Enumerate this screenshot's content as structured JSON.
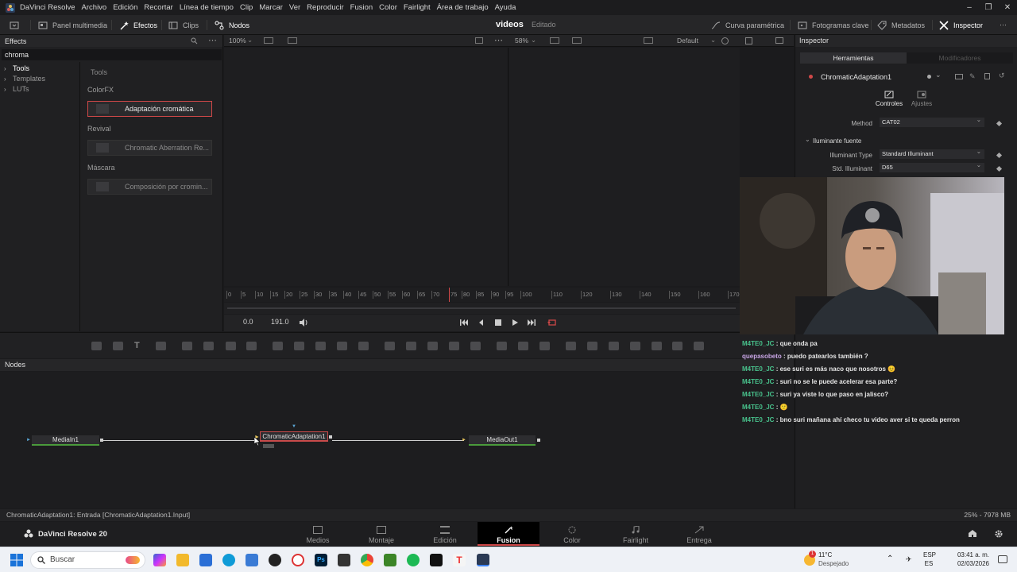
{
  "menubar": {
    "app_name": "DaVinci Resolve",
    "items": [
      "Archivo",
      "Edición",
      "Recortar",
      "Línea de tiempo",
      "Clip",
      "Marcar",
      "Ver",
      "Reproducir",
      "Fusion",
      "Color",
      "Fairlight",
      "Área de trabajo",
      "Ayuda"
    ]
  },
  "toolbar": {
    "media_pool": "Panel multimedia",
    "effects": "Efectos",
    "clips": "Clips",
    "nodes": "Nodos",
    "project_title": "videos",
    "project_state": "Editado",
    "spline": "Curva paramétrica",
    "keyframes": "Fotogramas clave",
    "metadata": "Metadatos",
    "inspector": "Inspector"
  },
  "effects_panel": {
    "title": "Effects",
    "search_value": "chroma",
    "tree": [
      "Tools",
      "Templates",
      "LUTs"
    ],
    "list_header": "Tools",
    "categories": [
      {
        "name": "ColorFX",
        "item": "Adaptación cromática"
      },
      {
        "name": "Revival",
        "item": "Chromatic Aberration Re..."
      },
      {
        "name": "Máscara",
        "item": "Composición por cromin..."
      }
    ]
  },
  "viewer": {
    "zoom_left": "100%",
    "zoom_right": "58%",
    "layout": "Default",
    "ruler_ticks": [
      "0",
      "5",
      "10",
      "15",
      "20",
      "25",
      "30",
      "35",
      "40",
      "45",
      "50",
      "55",
      "60",
      "65",
      "70",
      "75",
      "80",
      "85",
      "90",
      "95",
      "100",
      "110",
      "120",
      "130",
      "140",
      "150",
      "160",
      "170"
    ],
    "time_start": "0.0",
    "time_end": "191.0"
  },
  "nodes": {
    "title": "Nodes",
    "items": [
      "MediaIn1",
      "ChromaticAdaptation1",
      "MediaOut1"
    ]
  },
  "inspector": {
    "title": "Inspector",
    "tab_tools": "Herramientas",
    "tab_modifiers": "Modificadores",
    "tool_name": "ChromaticAdaptation1",
    "sub_controls": "Controles",
    "sub_settings": "Ajustes",
    "method_label": "Method",
    "method_value": "CAT02",
    "section": "Iluminante fuente",
    "illuminant_type_label": "Illuminant Type",
    "illuminant_type_value": "Standard Illuminant",
    "std_illuminant_label": "Std. Illuminant",
    "std_illuminant_value": "D65"
  },
  "chat": [
    {
      "user": "M4TE0_JC",
      "msg": " : que onda pa"
    },
    {
      "user": "quepasobeto",
      "msg": " : puedo patearlos también ?"
    },
    {
      "user": "M4TE0_JC",
      "msg": " : ese suri es más naco que nosotros 😊"
    },
    {
      "user": "M4TE0_JC",
      "msg": " : suri no se le puede acelerar esa parte?"
    },
    {
      "user": "M4TE0_JC",
      "msg": " : suri ya viste lo que paso en jalisco?"
    },
    {
      "user": "M4TE0_JC",
      "msg": " : 🙂"
    },
    {
      "user": "M4TE0_JC",
      "msg": " : bno suri mañana ahí checo tu video aver si te queda perron"
    }
  ],
  "statusbar": {
    "left": "ChromaticAdaptation1: Entrada  [ChromaticAdaptation1.Input]",
    "right": "25% - 7978 MB"
  },
  "pages": {
    "brand": "DaVinci Resolve 20",
    "tabs": [
      "Medios",
      "Montaje",
      "Edición",
      "Fusion",
      "Color",
      "Fairlight",
      "Entrega"
    ],
    "active": "Fusion"
  },
  "taskbar": {
    "search": "Buscar",
    "weather_temp": "11°C",
    "weather_desc": "Despejado",
    "lang_top": "ESP",
    "lang_bottom": "ES",
    "time": "03:41 a. m.",
    "date": "02/03/2026",
    "notification_count": "1"
  },
  "colors": {
    "accent_red": "#d04848",
    "chat_user_green": "#48c28c",
    "node_green": "#4a9a3b"
  }
}
